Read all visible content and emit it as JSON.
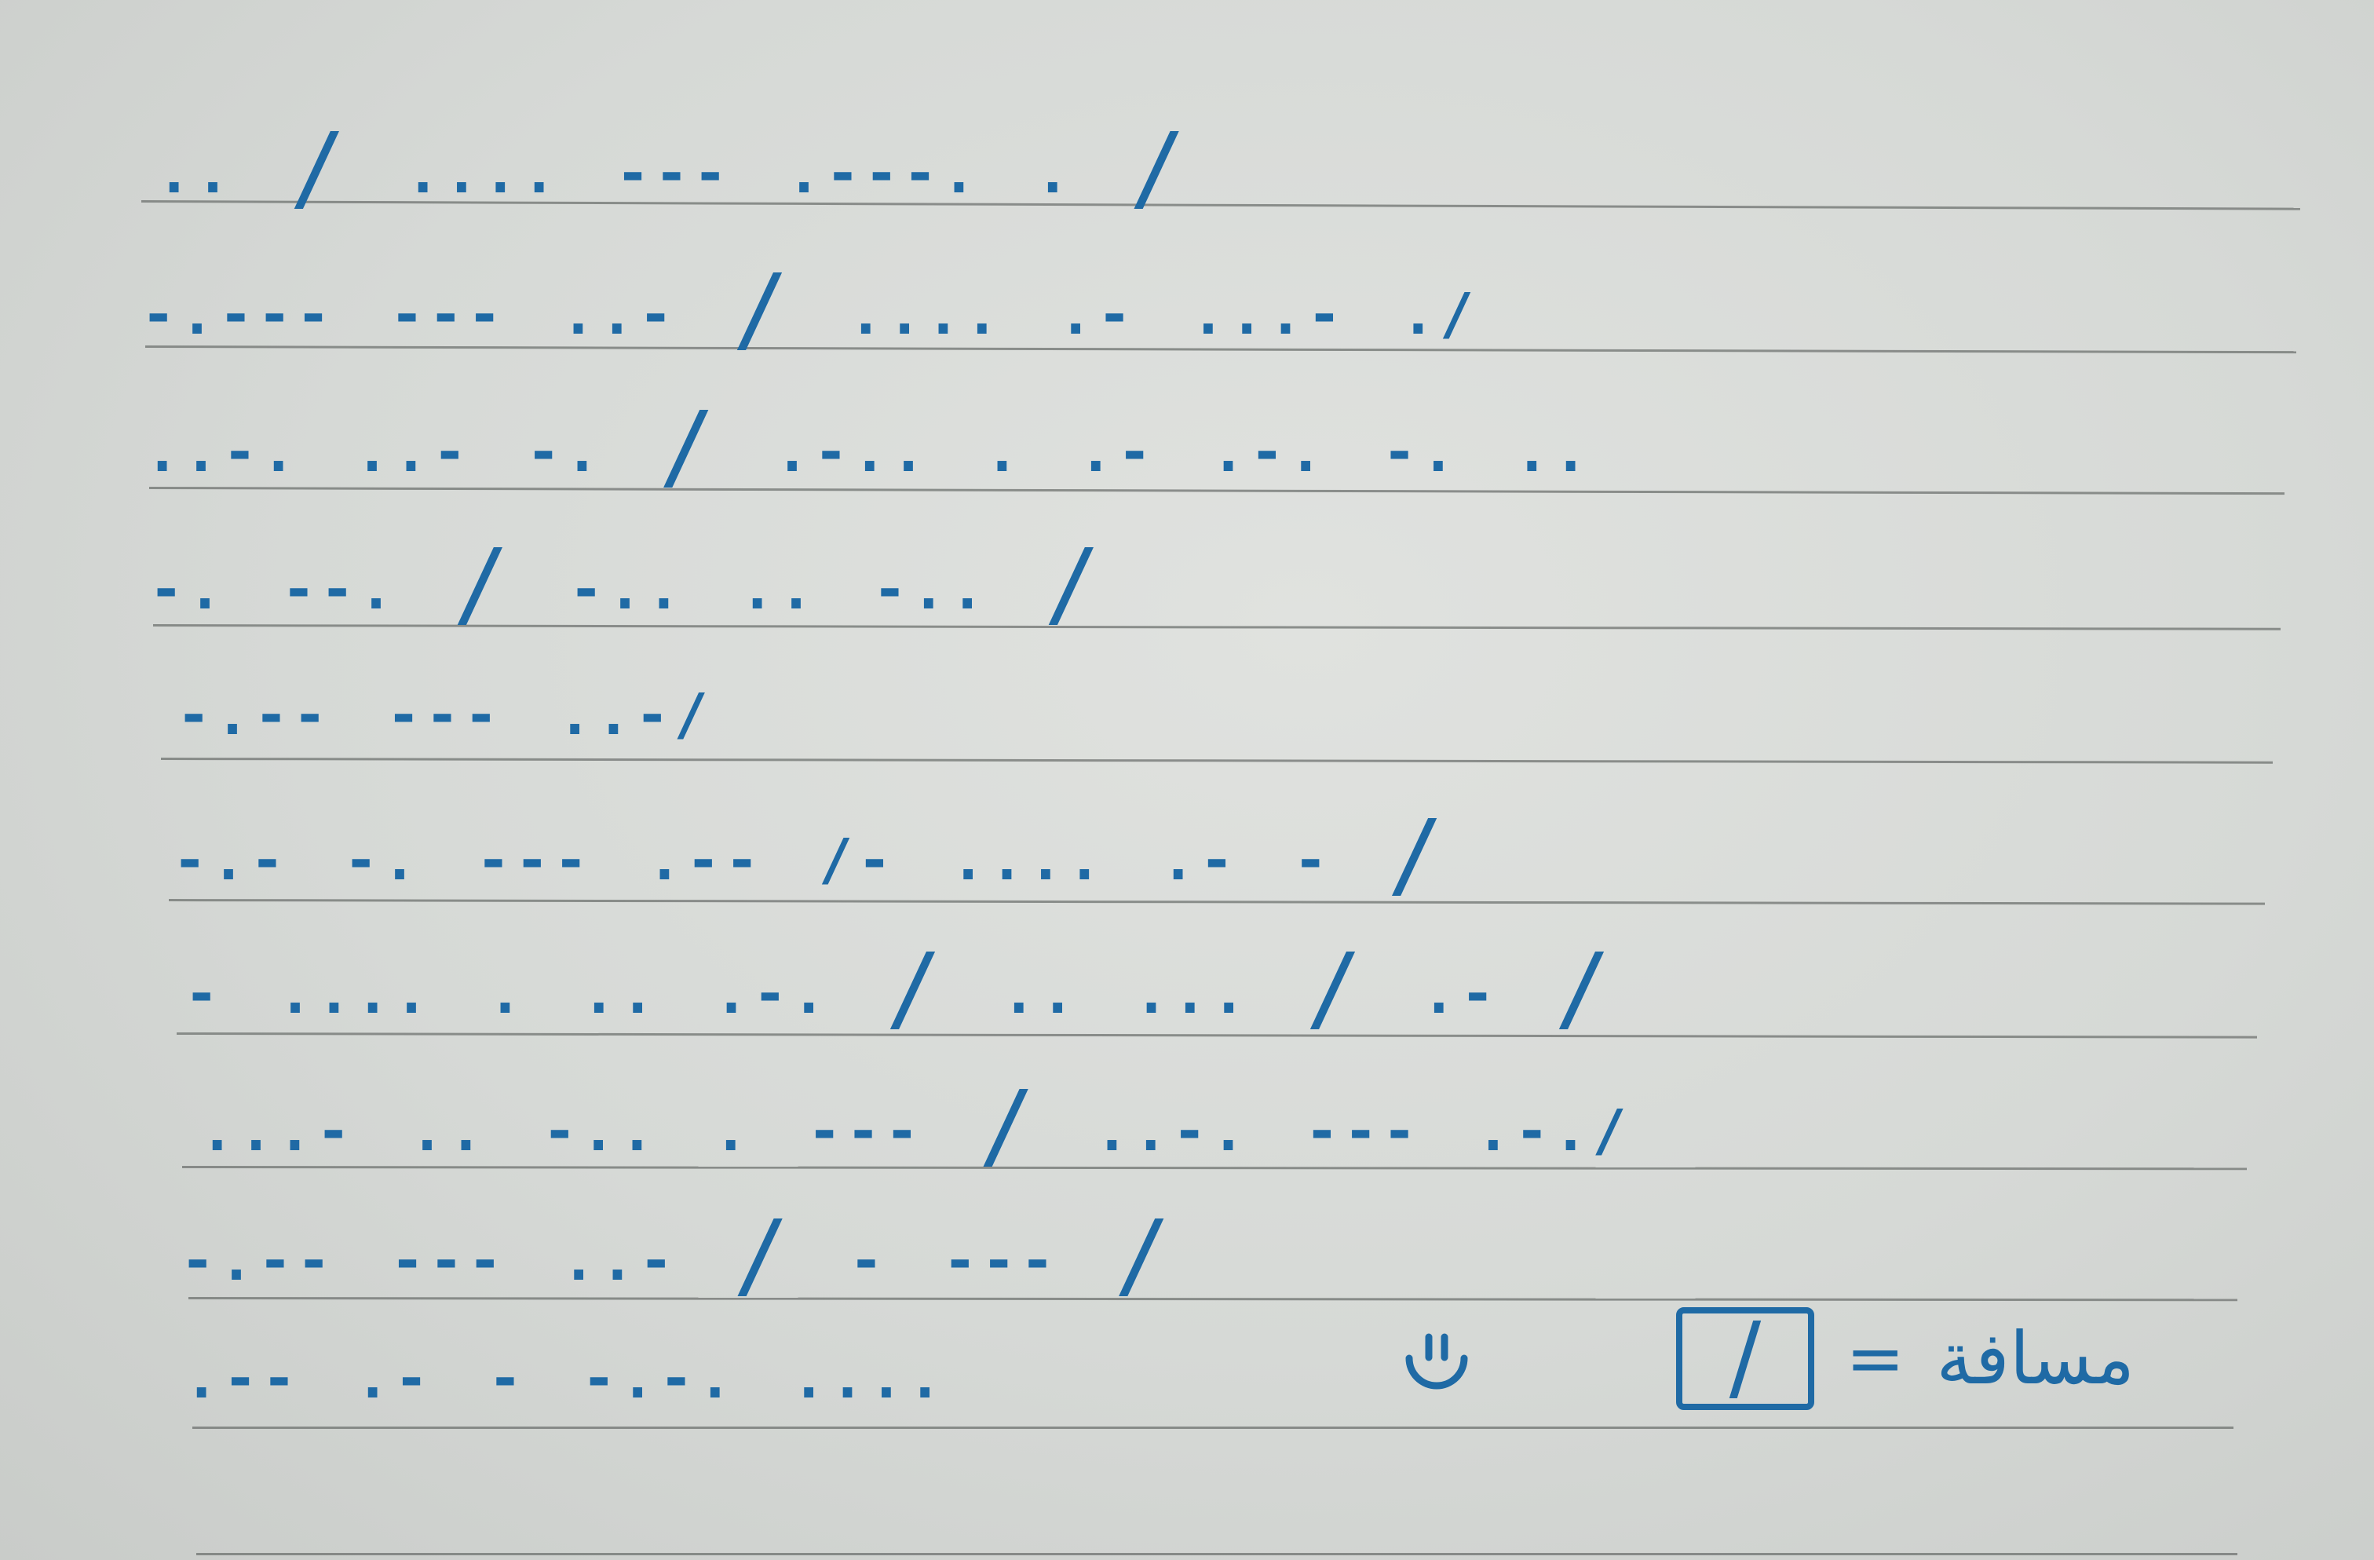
{
  "lines": [
    [
      "..",
      "/",
      "....",
      "---",
      ".---.",
      ".",
      "/"
    ],
    [
      "-.---",
      "---",
      "..-",
      "/",
      "....",
      ".-",
      "...-",
      "./"
    ],
    [
      "..-.",
      "..-",
      "-.",
      "/",
      ".-..",
      ".",
      ".-",
      ".-.",
      "-.",
      ".."
    ],
    [
      "-.",
      "--.",
      "/",
      "-..",
      "..",
      "-..",
      "/"
    ],
    [
      "-.--",
      "---",
      "..-/"
    ],
    [
      "-.-",
      "-.",
      "---",
      ".--",
      "/-",
      "....",
      ".-",
      "-",
      "/"
    ],
    [
      "-",
      "....",
      ".",
      "..",
      ".-.",
      "/",
      "..",
      "...",
      "/",
      ".-",
      "/"
    ],
    [
      "...-",
      "..",
      "-..",
      ".",
      "---",
      "/",
      "..-.",
      "---",
      ".-./"
    ],
    [
      "-.--",
      "---",
      "..-",
      "/",
      "-",
      "---",
      "/"
    ],
    [
      ".--",
      ".-",
      "-",
      "-.-.",
      "...."
    ]
  ],
  "legend": {
    "symbol": "/",
    "equals": "=",
    "word": "مسافة"
  },
  "colors": {
    "ink": "#1f6aa5",
    "rule": "#6e716f"
  },
  "icons": [
    "smiley-face-icon"
  ]
}
